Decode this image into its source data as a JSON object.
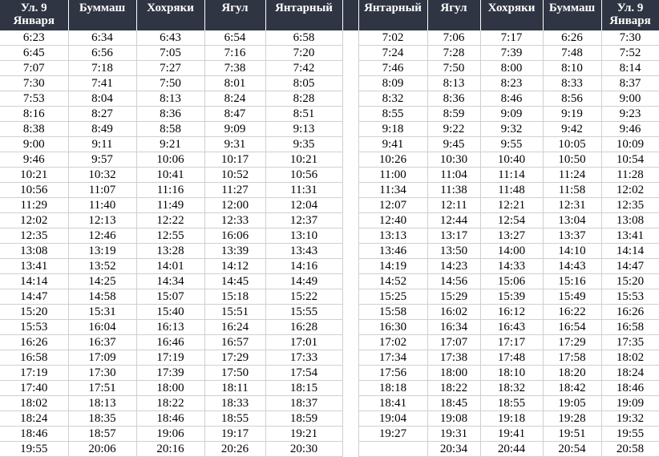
{
  "headers_left": [
    "Ул. 9 Января",
    "Буммаш",
    "Хохряки",
    "Ягул",
    "Янтарный"
  ],
  "headers_right": [
    "Янтарный",
    "Ягул",
    "Хохряки",
    "Буммаш",
    "Ул. 9 Января"
  ],
  "rows": [
    {
      "left": [
        "6:23",
        "6:34",
        "6:43",
        "6:54",
        "6:58"
      ],
      "right": [
        "7:02",
        "7:06",
        "7:17",
        "6:26",
        "7:30"
      ]
    },
    {
      "left": [
        "6:45",
        "6:56",
        "7:05",
        "7:16",
        "7:20"
      ],
      "right": [
        "7:24",
        "7:28",
        "7:39",
        "7:48",
        "7:52"
      ]
    },
    {
      "left": [
        "7:07",
        "7:18",
        "7:27",
        "7:38",
        "7:42"
      ],
      "right": [
        "7:46",
        "7:50",
        "8:00",
        "8:10",
        "8:14"
      ]
    },
    {
      "left": [
        "7:30",
        "7:41",
        "7:50",
        "8:01",
        "8:05"
      ],
      "right": [
        "8:09",
        "8:13",
        "8:23",
        "8:33",
        "8:37"
      ]
    },
    {
      "left": [
        "7:53",
        "8:04",
        "8:13",
        "8:24",
        "8:28"
      ],
      "right": [
        "8:32",
        "8:36",
        "8:46",
        "8:56",
        "9:00"
      ]
    },
    {
      "left": [
        "8:16",
        "8:27",
        "8:36",
        "8:47",
        "8:51"
      ],
      "right": [
        "8:55",
        "8:59",
        "9:09",
        "9:19",
        "9:23"
      ]
    },
    {
      "left": [
        "8:38",
        "8:49",
        "8:58",
        "9:09",
        "9:13"
      ],
      "right": [
        "9:18",
        "9:22",
        "9:32",
        "9:42",
        "9:46"
      ]
    },
    {
      "left": [
        "9:00",
        "9:11",
        "9:21",
        "9:31",
        "9:35"
      ],
      "right": [
        "9:41",
        "9:45",
        "9:55",
        "10:05",
        "10:09"
      ]
    },
    {
      "left": [
        "9:46",
        "9:57",
        "10:06",
        "10:17",
        "10:21"
      ],
      "right": [
        "10:26",
        "10:30",
        "10:40",
        "10:50",
        "10:54"
      ]
    },
    {
      "left": [
        "10:21",
        "10:32",
        "10:41",
        "10:52",
        "10:56"
      ],
      "right": [
        "11:00",
        "11:04",
        "11:14",
        "11:24",
        "11:28"
      ]
    },
    {
      "left": [
        "10:56",
        "11:07",
        "11:16",
        "11:27",
        "11:31"
      ],
      "right": [
        "11:34",
        "11:38",
        "11:48",
        "11:58",
        "12:02"
      ]
    },
    {
      "left": [
        "11:29",
        "11:40",
        "11:49",
        "12:00",
        "12:04"
      ],
      "right": [
        "12:07",
        "12:11",
        "12:21",
        "12:31",
        "12:35"
      ]
    },
    {
      "left": [
        "12:02",
        "12:13",
        "12:22",
        "12:33",
        "12:37"
      ],
      "right": [
        "12:40",
        "12:44",
        "12:54",
        "13:04",
        "13:08"
      ]
    },
    {
      "left": [
        "12:35",
        "12:46",
        "12:55",
        "16:06",
        "13:10"
      ],
      "right": [
        "13:13",
        "13:17",
        "13:27",
        "13:37",
        "13:41"
      ]
    },
    {
      "left": [
        "13:08",
        "13:19",
        "13:28",
        "13:39",
        "13:43"
      ],
      "right": [
        "13:46",
        "13:50",
        "14:00",
        "14:10",
        "14:14"
      ]
    },
    {
      "left": [
        "13:41",
        "13:52",
        "14:01",
        "14:12",
        "14:16"
      ],
      "right": [
        "14:19",
        "14:23",
        "14:33",
        "14:43",
        "14:47"
      ]
    },
    {
      "left": [
        "14:14",
        "14:25",
        "14:34",
        "14:45",
        "14:49"
      ],
      "right": [
        "14:52",
        "14:56",
        "15:06",
        "15:16",
        "15:20"
      ]
    },
    {
      "left": [
        "14:47",
        "14:58",
        "15:07",
        "15:18",
        "15:22"
      ],
      "right": [
        "15:25",
        "15:29",
        "15:39",
        "15:49",
        "15:53"
      ]
    },
    {
      "left": [
        "15:20",
        "15:31",
        "15:40",
        "15:51",
        "15:55"
      ],
      "right": [
        "15:58",
        "16:02",
        "16:12",
        "16:22",
        "16:26"
      ]
    },
    {
      "left": [
        "15:53",
        "16:04",
        "16:13",
        "16:24",
        "16:28"
      ],
      "right": [
        "16:30",
        "16:34",
        "16:43",
        "16:54",
        "16:58"
      ]
    },
    {
      "left": [
        "16:26",
        "16:37",
        "16:46",
        "16:57",
        "17:01"
      ],
      "right": [
        "17:02",
        "17:07",
        "17:17",
        "17:29",
        "17:35"
      ]
    },
    {
      "left": [
        "16:58",
        "17:09",
        "17:19",
        "17:29",
        "17:33"
      ],
      "right": [
        "17:34",
        "17:38",
        "17:48",
        "17:58",
        "18:02"
      ]
    },
    {
      "left": [
        "17:19",
        "17:30",
        "17:39",
        "17:50",
        "17:54"
      ],
      "right": [
        "17:56",
        "18:00",
        "18:10",
        "18:20",
        "18:24"
      ]
    },
    {
      "left": [
        "17:40",
        "17:51",
        "18:00",
        "18:11",
        "18:15"
      ],
      "right": [
        "18:18",
        "18:22",
        "18:32",
        "18:42",
        "18:46"
      ]
    },
    {
      "left": [
        "18:02",
        "18:13",
        "18:22",
        "18:33",
        "18:37"
      ],
      "right": [
        "18:41",
        "18:45",
        "18:55",
        "19:05",
        "19:09"
      ]
    },
    {
      "left": [
        "18:24",
        "18:35",
        "18:46",
        "18:55",
        "18:59"
      ],
      "right": [
        "19:04",
        "19:08",
        "19:18",
        "19:28",
        "19:32"
      ]
    },
    {
      "left": [
        "18:46",
        "18:57",
        "19:06",
        "19:17",
        "19:21"
      ],
      "right": [
        "19:27",
        "19:31",
        "19:41",
        "19:51",
        "19:55"
      ]
    },
    {
      "left": [
        "19:55",
        "20:06",
        "20:16",
        "20:26",
        "20:30"
      ],
      "right": [
        "",
        "20:34",
        "20:44",
        "20:54",
        "20:58"
      ]
    }
  ]
}
